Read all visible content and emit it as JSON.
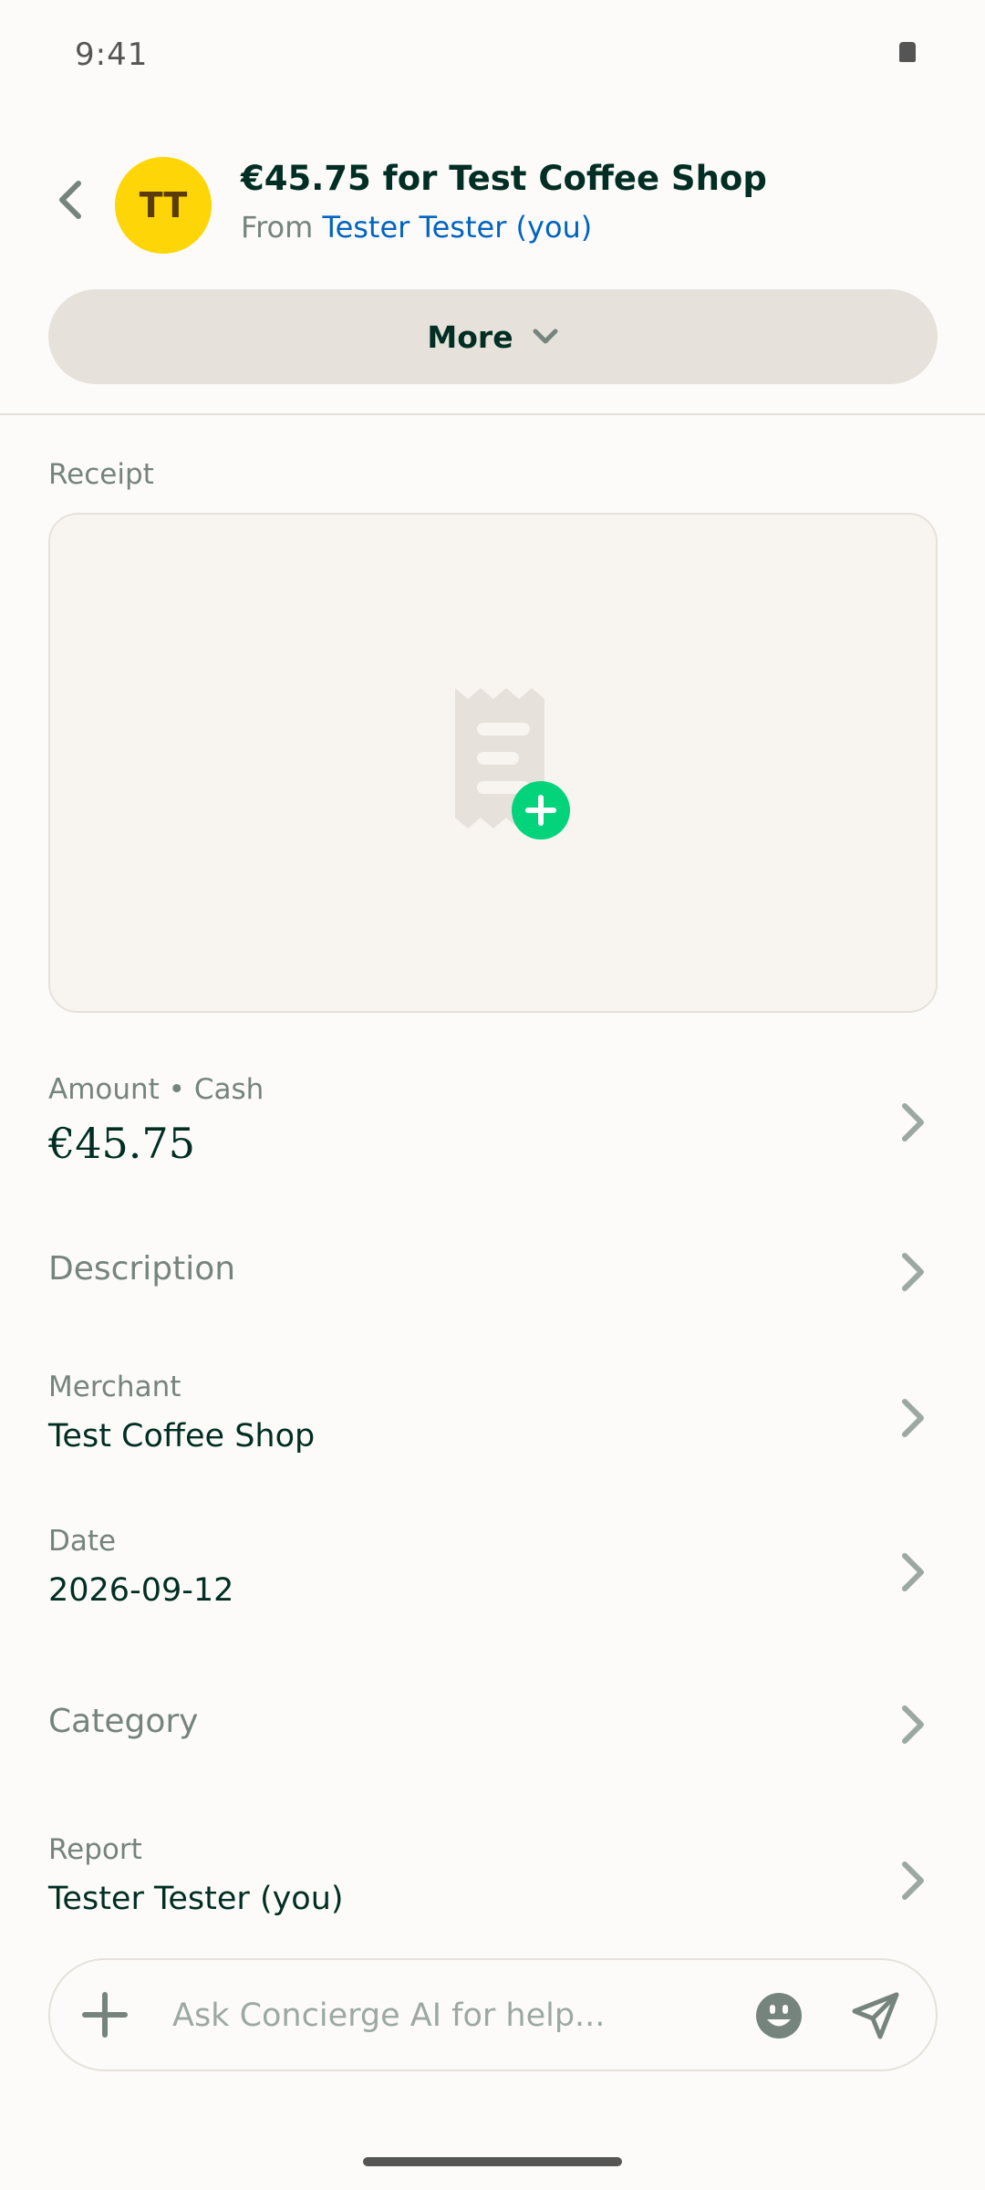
{
  "status_bar": {
    "time": "9:41"
  },
  "header": {
    "avatar_initials": "TT",
    "title": "€45.75 for Test Coffee Shop",
    "from_prefix": "From ",
    "from_name": "Tester Tester (you)",
    "more_label": "More"
  },
  "receipt": {
    "label": "Receipt"
  },
  "fields": {
    "amount": {
      "label": "Amount • Cash",
      "value": "€45.75"
    },
    "description": {
      "label": "Description"
    },
    "merchant": {
      "label": "Merchant",
      "value": "Test Coffee Shop"
    },
    "date": {
      "label": "Date",
      "value": "2026-09-12"
    },
    "category": {
      "label": "Category"
    },
    "report": {
      "label": "Report",
      "value": "Tester Tester (you)"
    }
  },
  "composer": {
    "placeholder": "Ask Concierge AI for help..."
  },
  "colors": {
    "accent_green": "#03D47C",
    "link_blue": "#0164BF",
    "avatar_yellow": "#FED607",
    "text_dark": "#002E22",
    "text_muted": "#76847E"
  }
}
